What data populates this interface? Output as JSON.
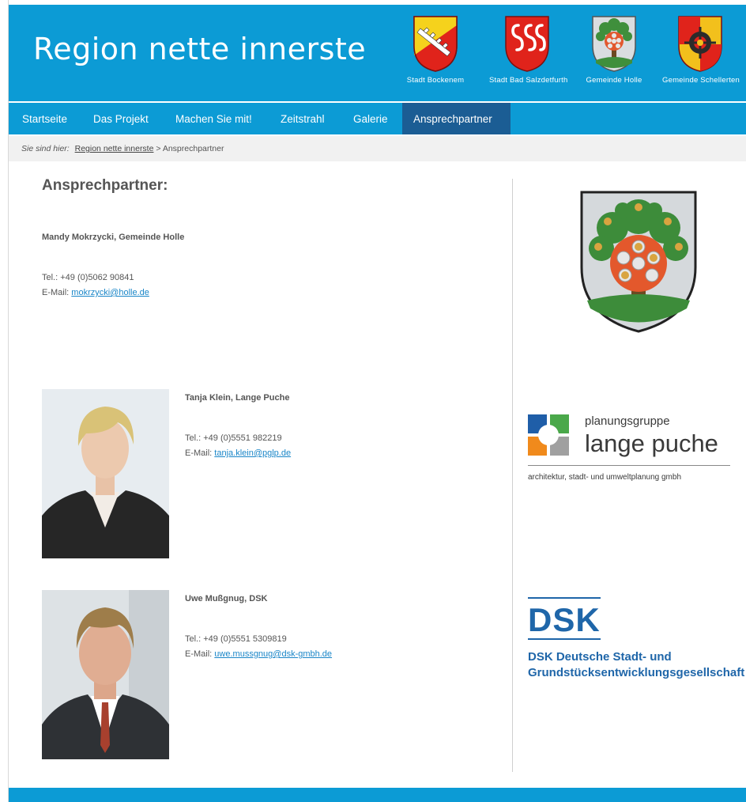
{
  "header": {
    "title": "Region nette innerste",
    "crests": [
      {
        "label": "Stadt Bockenem",
        "icon": "bockenem-crest-icon"
      },
      {
        "label": "Stadt Bad Salzdetfurth",
        "icon": "bad-salzdetfurth-crest-icon"
      },
      {
        "label": "Gemeinde Holle",
        "icon": "holle-crest-icon"
      },
      {
        "label": "Gemeinde Schellerten",
        "icon": "schellerten-crest-icon"
      }
    ],
    "colors": {
      "primary": "#0c9bd5",
      "nav_active": "#1b5d94",
      "link": "#1a86c8"
    }
  },
  "nav": {
    "items": [
      {
        "label": "Startseite"
      },
      {
        "label": "Das Projekt"
      },
      {
        "label": "Machen Sie mit!"
      },
      {
        "label": "Zeitstrahl"
      },
      {
        "label": "Galerie"
      },
      {
        "label": "Ansprechpartner"
      }
    ],
    "active": "Ansprechpartner"
  },
  "breadcrumb": {
    "prefix": "Sie sind hier:",
    "link": "Region nette innerste",
    "separator": " > ",
    "current": "Ansprechpartner"
  },
  "main": {
    "title": "Ansprechpartner:",
    "contacts": [
      {
        "name": "Mandy Mokrzycki, Gemeinde Holle",
        "tel": "Tel.: +49 (0)5062 90841",
        "email_label": "E-Mail:",
        "email": "mokrzycki@holle.de"
      },
      {
        "name": "Tanja Klein, Lange Puche",
        "tel": "Tel.: +49 (0)5551 982219",
        "email_label": "E-Mail:",
        "email": "tanja.klein@pglp.de"
      },
      {
        "name": "Uwe Mußgnug, DSK",
        "tel": "Tel.: +49 (0)5551 5309819",
        "email_label": "E-Mail:",
        "email": "uwe.mussgnug@dsk-gmbh.de"
      }
    ]
  },
  "logos": {
    "lange_puche": {
      "line1": "planungsgruppe",
      "line2": "lange puche",
      "sub": "architektur, stadt- und umweltplanung gmbh"
    },
    "dsk": {
      "mark": "DSK",
      "line1": "DSK Deutsche Stadt- und",
      "line2": "Grundstücksentwicklungsgesellschaft"
    }
  }
}
